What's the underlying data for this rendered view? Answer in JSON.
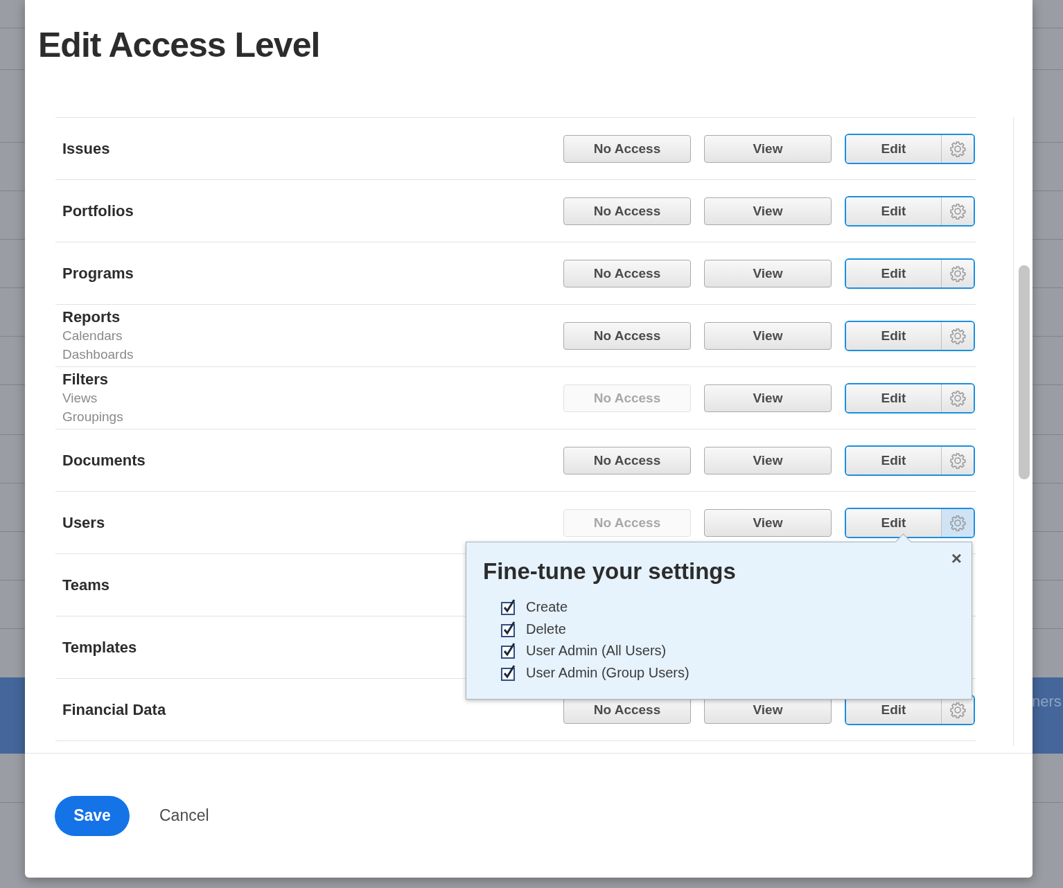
{
  "background": {
    "band_text": "ners"
  },
  "dialog": {
    "title": "Edit Access Level",
    "rows": [
      {
        "label": "Issues",
        "options": [
          {
            "label": "No Access",
            "selected": false,
            "disabled": false
          },
          {
            "label": "View",
            "selected": false,
            "disabled": false
          },
          {
            "label": "Edit",
            "selected": true,
            "disabled": false
          }
        ],
        "settings": {
          "open": false
        }
      },
      {
        "label": "Portfolios",
        "options": [
          {
            "label": "No Access",
            "selected": false,
            "disabled": false
          },
          {
            "label": "View",
            "selected": false,
            "disabled": false
          },
          {
            "label": "Edit",
            "selected": true,
            "disabled": false
          }
        ],
        "settings": {
          "open": false
        }
      },
      {
        "label": "Programs",
        "options": [
          {
            "label": "No Access",
            "selected": false,
            "disabled": false
          },
          {
            "label": "View",
            "selected": false,
            "disabled": false
          },
          {
            "label": "Edit",
            "selected": true,
            "disabled": false
          }
        ],
        "settings": {
          "open": false
        }
      },
      {
        "label": "Reports",
        "sublabels": [
          "Calendars",
          "Dashboards"
        ],
        "options": [
          {
            "label": "No Access",
            "selected": false,
            "disabled": false
          },
          {
            "label": "View",
            "selected": false,
            "disabled": false
          },
          {
            "label": "Edit",
            "selected": true,
            "disabled": false
          }
        ],
        "settings": {
          "open": false
        }
      },
      {
        "label": "Filters",
        "sublabels": [
          "Views",
          "Groupings"
        ],
        "options": [
          {
            "label": "No Access",
            "selected": false,
            "disabled": true
          },
          {
            "label": "View",
            "selected": false,
            "disabled": false
          },
          {
            "label": "Edit",
            "selected": true,
            "disabled": false
          }
        ],
        "settings": {
          "open": false
        }
      },
      {
        "label": "Documents",
        "options": [
          {
            "label": "No Access",
            "selected": false,
            "disabled": false
          },
          {
            "label": "View",
            "selected": false,
            "disabled": false
          },
          {
            "label": "Edit",
            "selected": true,
            "disabled": false
          }
        ],
        "settings": {
          "open": false
        }
      },
      {
        "label": "Users",
        "options": [
          {
            "label": "No Access",
            "selected": false,
            "disabled": true
          },
          {
            "label": "View",
            "selected": false,
            "disabled": false
          },
          {
            "label": "Edit",
            "selected": true,
            "disabled": false
          }
        ],
        "settings": {
          "open": true
        }
      },
      {
        "label": "Teams"
      },
      {
        "label": "Templates"
      },
      {
        "label": "Financial Data",
        "options": [
          {
            "label": "No Access",
            "selected": false,
            "disabled": false
          },
          {
            "label": "View",
            "selected": false,
            "disabled": false
          },
          {
            "label": "Edit",
            "selected": true,
            "disabled": false
          }
        ],
        "settings": {
          "open": false
        }
      }
    ],
    "popover": {
      "title": "Fine-tune your settings",
      "close": "×",
      "options": [
        {
          "label": "Create",
          "checked": true
        },
        {
          "label": "Delete",
          "checked": true
        },
        {
          "label": "User Admin (All Users)",
          "checked": true
        },
        {
          "label": "User Admin (Group Users)",
          "checked": true
        }
      ]
    },
    "footer": {
      "buttons": [
        {
          "label": "Save",
          "kind": "primary"
        },
        {
          "label": "Cancel",
          "kind": "secondary"
        }
      ]
    }
  }
}
